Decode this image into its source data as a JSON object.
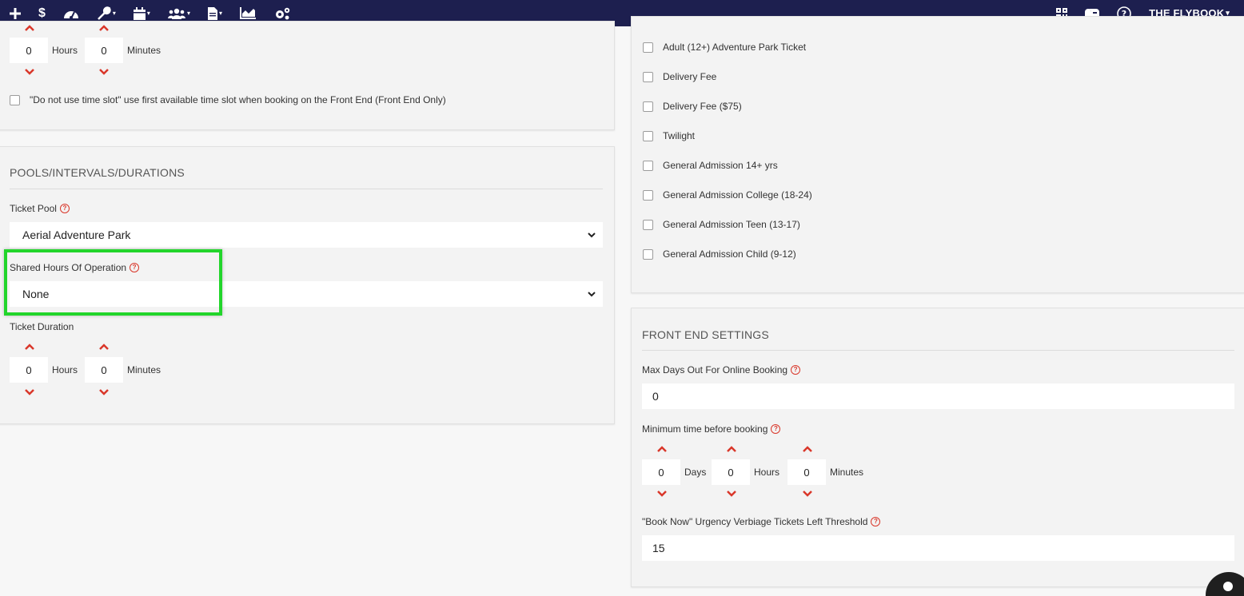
{
  "nav": {
    "left_icons": [
      "plus-icon",
      "dollar-icon",
      "dashboard-icon",
      "wrench-icon",
      "calendar-icon",
      "users-icon",
      "document-icon",
      "chart-icon",
      "gears-icon"
    ],
    "right_icons": [
      "qr-code-icon",
      "mailbox-icon",
      "help-icon"
    ],
    "brand": "THE FLYBOOK"
  },
  "top_left": {
    "hours_value": "0",
    "hours_label": "Hours",
    "minutes_value": "0",
    "minutes_label": "Minutes",
    "no_time_slot_label": "\"Do not use time slot\" use first available time slot when booking on the Front End (Front End Only)"
  },
  "pools": {
    "title": "POOLS/INTERVALS/DURATIONS",
    "ticket_pool_label": "Ticket Pool",
    "ticket_pool_value": "Aerial Adventure Park",
    "shared_hours_label": "Shared Hours Of Operation",
    "shared_hours_value": "None",
    "ticket_duration_label": "Ticket Duration",
    "hours_value": "0",
    "hours_label": "Hours",
    "minutes_value": "0",
    "minutes_label": "Minutes"
  },
  "tickets": {
    "items": [
      "Adult (12+) Adventure Park Ticket",
      "Delivery Fee",
      "Delivery Fee ($75)",
      "Twilight",
      "General Admission 14+ yrs",
      "General Admission College (18-24)",
      "General Admission Teen (13-17)",
      "General Admission Child (9-12)"
    ]
  },
  "front_end": {
    "title": "FRONT END SETTINGS",
    "max_days_label": "Max Days Out For Online Booking",
    "max_days_value": "0",
    "min_time_label": "Minimum time before booking",
    "days_value": "0",
    "days_label": "Days",
    "hours_value": "0",
    "hours_label": "Hours",
    "minutes_value": "0",
    "minutes_label": "Minutes",
    "urgency_label": "\"Book Now\" Urgency Verbiage Tickets Left Threshold",
    "urgency_value": "15"
  },
  "colors": {
    "nav_bg": "#1d1f4f",
    "accent_red": "#d9372a",
    "highlight_green": "#22d52b"
  }
}
